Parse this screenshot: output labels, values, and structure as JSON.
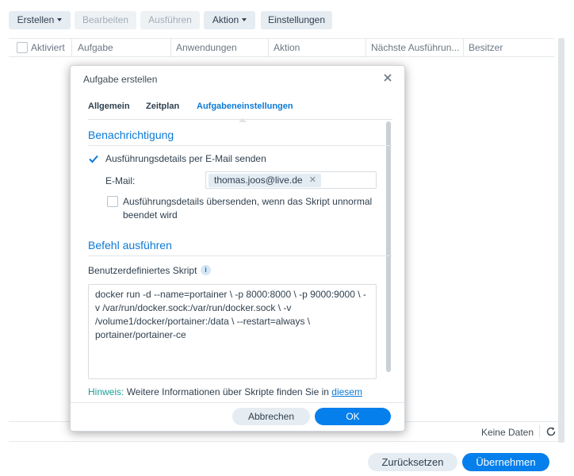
{
  "toolbar": {
    "create_label": "Erstellen",
    "edit_label": "Bearbeiten",
    "run_label": "Ausführen",
    "action_label": "Aktion",
    "settings_label": "Einstellungen"
  },
  "grid": {
    "columns": [
      "Aktiviert",
      "Aufgabe",
      "Anwendungen",
      "Aktion",
      "Nächste Ausführun...",
      "Besitzer"
    ],
    "empty_text": "Keine Daten"
  },
  "page_buttons": {
    "reset_label": "Zurücksetzen",
    "apply_label": "Übernehmen"
  },
  "dialog": {
    "title": "Aufgabe erstellen",
    "tabs": [
      "Allgemein",
      "Zeitplan",
      "Aufgabeneinstellungen"
    ],
    "notification": {
      "section_title": "Benachrichtigung",
      "send_details_label": "Ausführungsdetails per E-Mail senden",
      "email_label": "E-Mail:",
      "email_value": "thomas.joos@live.de",
      "abnormal_label_line1": "Ausführungsdetails übersenden, wenn das Skript unnormal",
      "abnormal_label_line2": "beendet wird"
    },
    "command": {
      "section_title": "Befehl ausführen",
      "script_label": "Benutzerdefiniertes Skript",
      "script_value": "docker run -d --name=portainer \\ -p 8000:8000 \\ -p 9000:9000 \\ -v /var/run/docker.sock:/var/run/docker.sock \\ -v /volume1/docker/portainer:/data \\ --restart=always \\ portainer/portainer-ce"
    },
    "hint": {
      "label": "Hinweis:",
      "text": " Weitere Informationen über Skripte finden Sie in ",
      "link": "diesem"
    },
    "cancel_label": "Abbrechen",
    "ok_label": "OK"
  },
  "colors": {
    "accent": "#057feb",
    "section_blue": "#0b7ad6",
    "hint_teal": "#1aa099"
  }
}
